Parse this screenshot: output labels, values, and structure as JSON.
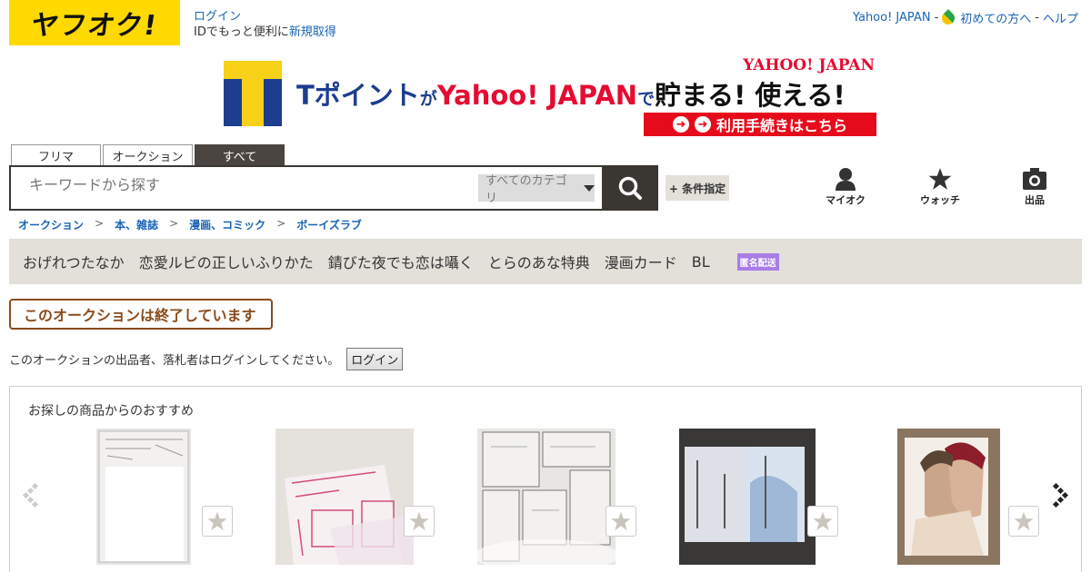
{
  "header": {
    "logo_text": "ヤフオク!",
    "login_label": "ログイン",
    "id_prompt": "IDでもっと便利に",
    "register_label": "新規取得",
    "top_links": {
      "yahoo_japan": "Yahoo! JAPAN",
      "sep1": "-",
      "first_time": "初めての方へ",
      "sep2": "-",
      "help": "ヘルプ"
    }
  },
  "banner": {
    "t_part": "Tポイント",
    "ga": "が",
    "yj": "Yahoo! JAPAN",
    "de": "で",
    "tamaru": "貯まる! 使える!",
    "yj_logo": "YAHOO! JAPAN",
    "cta": "利用手続きはこちら"
  },
  "search": {
    "tabs": [
      "フリマ",
      "オークション",
      "すべて"
    ],
    "active_tab": "すべて",
    "placeholder": "キーワードから探す",
    "category": "すべてのカテゴリ",
    "cond_button": "+ 条件指定"
  },
  "nav_icons": {
    "myauc": "マイオク",
    "watch": "ウォッチ",
    "sell": "出品"
  },
  "breadcrumb": [
    "オークション",
    "本、雑誌",
    "漫画、コミック",
    "ボーイズラブ"
  ],
  "breadcrumb_sep": ">",
  "keywords": [
    "おげれつたなか",
    "恋愛ルビの正しいふりかた",
    "錆びた夜でも恋は囁く",
    "とらのあな特典",
    "漫画カード",
    "BL"
  ],
  "anon_badge": "匿名配送",
  "notice": {
    "ended": "このオークションは終了しています",
    "login_prompt": "このオークションの出品者、落札者はログインしてください。",
    "login_button": "ログイン"
  },
  "recommend": {
    "title": "お探しの商品からのおすすめ"
  },
  "colors": {
    "brand_yellow": "#ffd900",
    "link_blue": "#1a64b4",
    "dark": "#3a3632",
    "ended_brown": "#8a4b1c",
    "badge_purple": "#a97ce6"
  }
}
